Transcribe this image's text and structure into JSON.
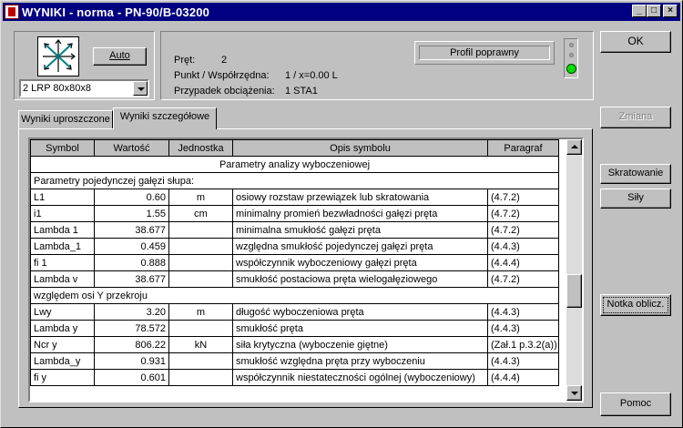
{
  "window": {
    "title": "WYNIKI - norma - PN-90/B-03200",
    "minimize": "_",
    "maximize": "□",
    "close": "×"
  },
  "section_selector": {
    "auto_button": "Auto",
    "profile_selected": "2 LRP 80x80x8"
  },
  "info": {
    "bar_label": "Pręt:",
    "bar_value": "2",
    "point_label": "Punkt / Współrzędna:",
    "point_value": "1 / x=0.00 L",
    "load_case_label": "Przypadek obciążenia:",
    "load_case_value": "1 STA1",
    "status": "Profil poprawny"
  },
  "buttons": {
    "ok": "OK",
    "change": "Zmiana",
    "lacing": "Skratowanie",
    "forces": "Siły",
    "calc_note": "Notka oblicz.",
    "help": "Pomoc"
  },
  "tabs": [
    {
      "label": "Wyniki uproszczone"
    },
    {
      "label": "Wyniki szczegółowe"
    }
  ],
  "table": {
    "headers": [
      "Symbol",
      "Wartość",
      "Jednostka",
      "Opis symbolu",
      "Paragraf"
    ],
    "title": "Parametry analizy wyboczeniowej",
    "section1": "Parametry pojedynczej gałęzi słupa:",
    "rows1": [
      {
        "symbol": "L1",
        "value": "0.60",
        "unit": "m",
        "desc": "osiowy rozstaw przewiązek lub skratowania",
        "para": "(4.7.2)"
      },
      {
        "symbol": "i1",
        "value": "1.55",
        "unit": "cm",
        "desc": "minimalny promień bezwładności gałęzi pręta",
        "para": "(4.7.2)"
      },
      {
        "symbol": "Lambda 1",
        "value": "38.677",
        "unit": "",
        "desc": "minimalna smukłość gałęzi pręta",
        "para": "(4.7.2)"
      },
      {
        "symbol": "Lambda_1",
        "value": "0.459",
        "unit": "",
        "desc": "względna smukłość pojedynczej gałęzi pręta",
        "para": "(4.4.3)"
      },
      {
        "symbol": "fi 1",
        "value": "0.888",
        "unit": "",
        "desc": "współczynnik wyboczeniowy gałęzi pręta",
        "para": "(4.4.4)"
      },
      {
        "symbol": "Lambda v",
        "value": "38.677",
        "unit": "",
        "desc": "smukłość postaciowa pręta wielogałęziowego",
        "para": "(4.7.2)"
      }
    ],
    "section2": "względem osi Y przekroju",
    "rows2": [
      {
        "symbol": "Lwy",
        "value": "3.20",
        "unit": "m",
        "desc": "długość wyboczeniowa pręta",
        "para": "(4.4.3)"
      },
      {
        "symbol": "Lambda y",
        "value": "78.572",
        "unit": "",
        "desc": "smukłość pręta",
        "para": "(4.4.3)"
      },
      {
        "symbol": "Ncr y",
        "value": "806.22",
        "unit": "kN",
        "desc": "siła krytyczna (wyboczenie giętne)",
        "para": "(Zał.1 p.3.2(a))"
      },
      {
        "symbol": "Lambda_y",
        "value": "0.931",
        "unit": "",
        "desc": "smukłość względna pręta przy wyboczeniu",
        "para": "(4.4.3)"
      },
      {
        "symbol": "fi y",
        "value": "0.601",
        "unit": "",
        "desc": "współczynnik niestateczności ogólnej (wyboczeniowy)",
        "para": "(4.4.4)"
      }
    ]
  }
}
